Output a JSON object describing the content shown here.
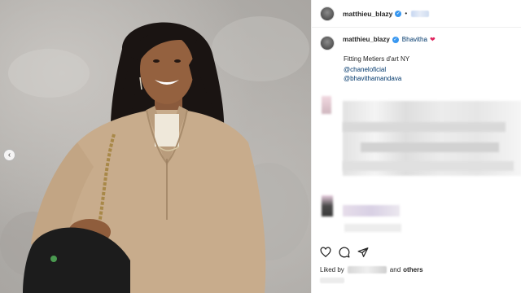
{
  "post": {
    "username": "matthieu_blazy",
    "header_separator": "•",
    "caption": {
      "username": "matthieu_blazy",
      "mention": "Bhavitha",
      "text": "Fitting Metiers d'art NY",
      "handles": [
        "@chaneloficial",
        "@bhavithamandava"
      ]
    },
    "liked_by_prefix": "Liked by",
    "liked_by_suffix": "others",
    "liked_by_joiner": "and"
  },
  "icons": {
    "prev": "chevron-left-icon",
    "like": "heart-outline-icon",
    "comment": "comment-bubble-icon",
    "share": "paper-plane-icon",
    "verified": "verified-badge-icon",
    "mention_heart": "red-heart-icon"
  },
  "colors": {
    "link": "#00376b",
    "verified": "#3897f0",
    "heart": "#e0245e",
    "sweater": "#c8ac8c"
  }
}
